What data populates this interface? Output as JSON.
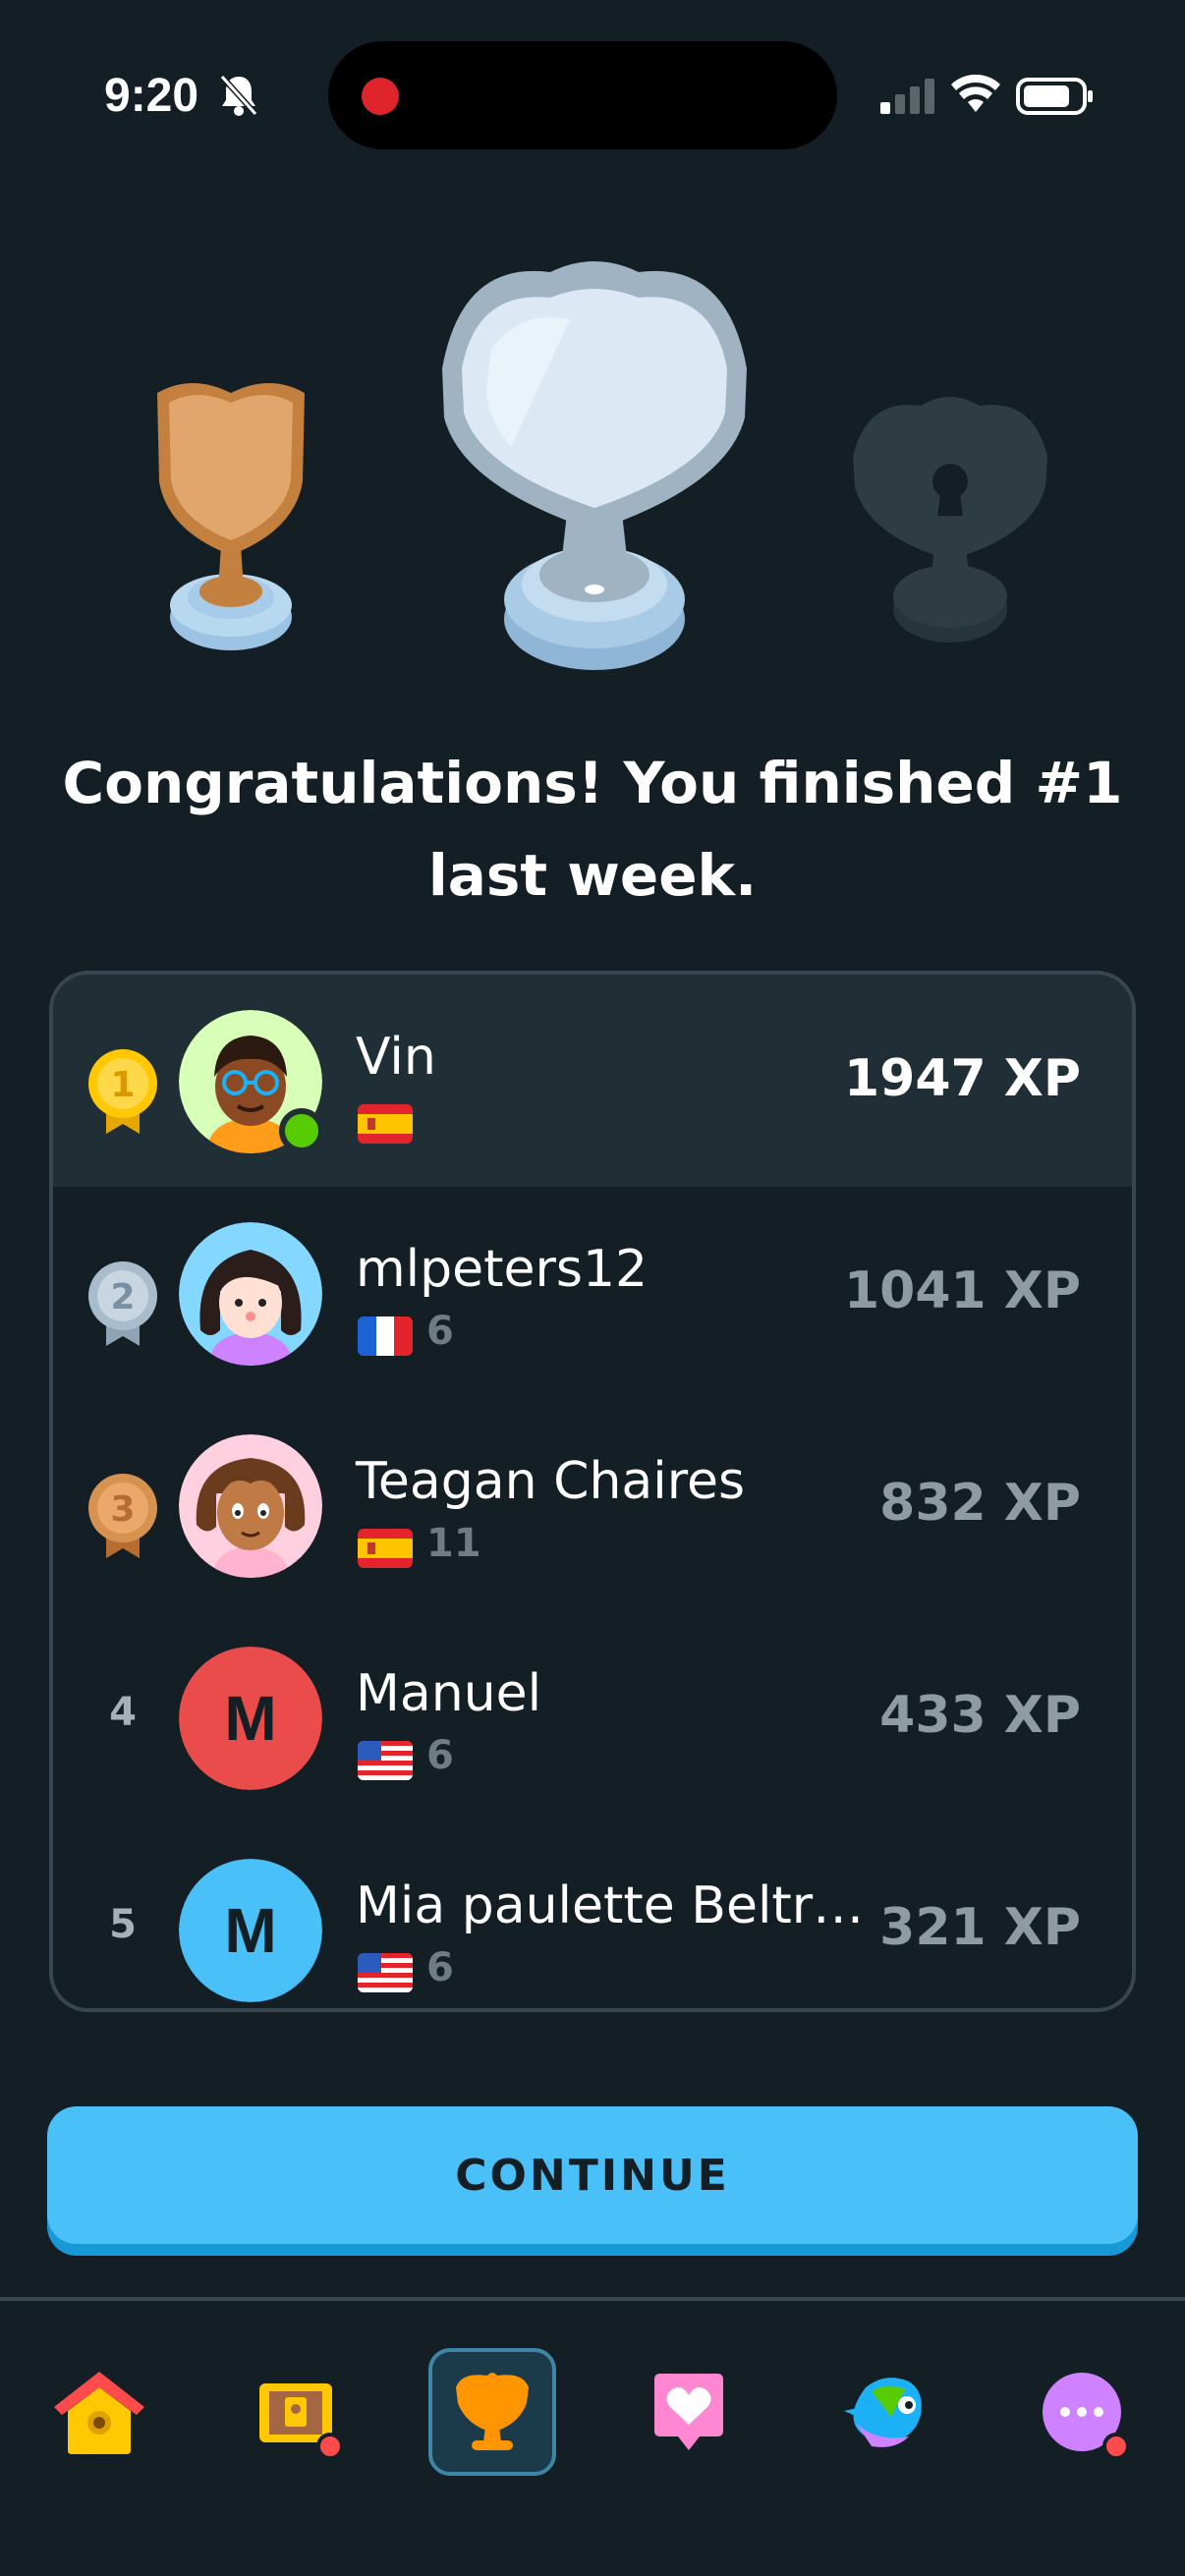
{
  "status_bar": {
    "time": "9:20"
  },
  "headline": "Congratulations! You finished #1 last week.",
  "leaderboard": {
    "rows": [
      {
        "rank": "1",
        "name": "Vin",
        "flag": "spain",
        "streak": "",
        "xp": "1947 XP",
        "avatar_bg": "#d7ffb8"
      },
      {
        "rank": "2",
        "name": "mlpeters12",
        "flag": "france",
        "streak": "6",
        "xp": "1041 XP",
        "avatar_bg": "#84d8ff"
      },
      {
        "rank": "3",
        "name": "Teagan Chaires",
        "flag": "spain",
        "streak": "11",
        "xp": "832 XP",
        "avatar_bg": "#ffd0e0"
      },
      {
        "rank": "4",
        "name": "Manuel",
        "flag": "usa",
        "streak": "6",
        "xp": "433 XP",
        "avatar_letter": "M",
        "avatar_bg": "#ea4b4b"
      },
      {
        "rank": "5",
        "name": "Mia paulette Beltr…",
        "flag": "usa",
        "streak": "6",
        "xp": "321 XP",
        "avatar_letter": "M",
        "avatar_bg": "#49c0f8"
      }
    ]
  },
  "continue_label": "CONTINUE",
  "colors": {
    "background": "#131f24",
    "accent_blue": "#49c0f8",
    "gold": "#ffc800",
    "silver": "#bcd4e6",
    "bronze": "#d7924f",
    "online": "#58cc02"
  },
  "nav": {
    "items": [
      "home-icon",
      "treasure-chest-icon",
      "trophy-icon",
      "heart-icon",
      "character-icon",
      "more-icon"
    ],
    "active": "trophy-icon"
  }
}
